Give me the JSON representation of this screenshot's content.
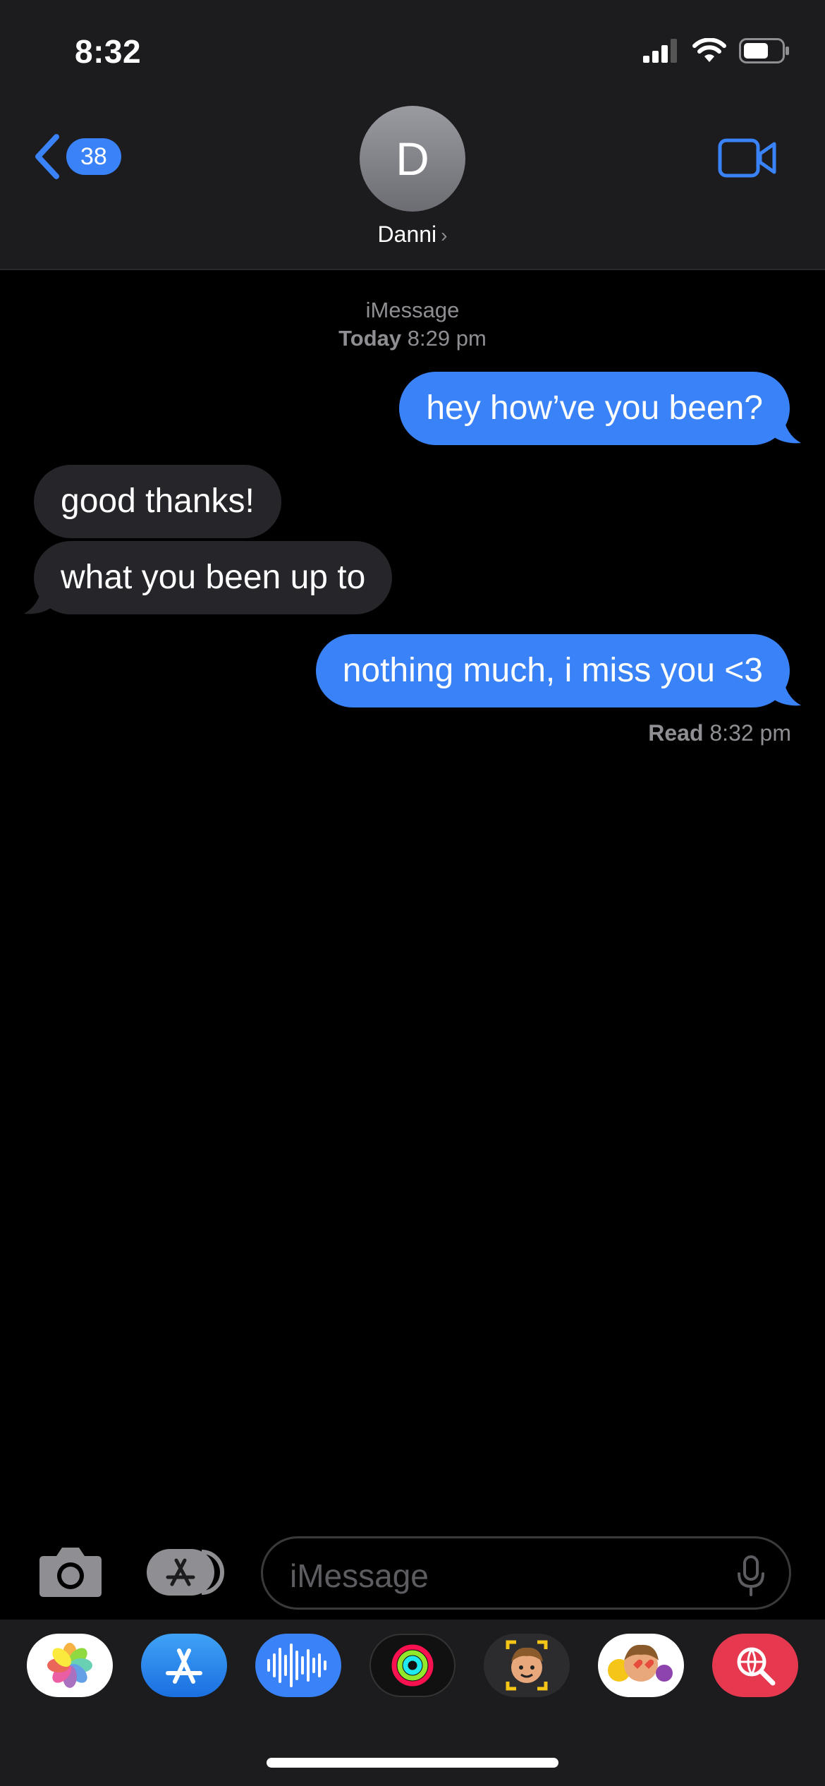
{
  "status_bar": {
    "time": "8:32"
  },
  "header": {
    "back_count": "38",
    "avatar_initial": "D",
    "contact_name": "Danni",
    "name_chevron": "›"
  },
  "conversation": {
    "service": "iMessage",
    "timestamp_day": "Today",
    "timestamp_time": "8:29 pm",
    "messages": [
      {
        "direction": "sent",
        "text": "hey how’ve you been?"
      },
      {
        "direction": "received",
        "text": "good thanks!"
      },
      {
        "direction": "received",
        "text": "what you been up to"
      },
      {
        "direction": "sent",
        "text": "nothing much, i miss you <3"
      }
    ],
    "read_label": "Read",
    "read_time": "8:32 pm"
  },
  "composer": {
    "placeholder": "iMessage",
    "icons": [
      "camera-icon",
      "app-store-toggle-icon",
      "microphone-icon"
    ]
  },
  "app_drawer": {
    "apps": [
      "photos-app-icon",
      "app-store-app-icon",
      "audio-message-app-icon",
      "activity-app-icon",
      "memoji-app-icon",
      "memoji-stickers-app-icon",
      "images-search-app-icon"
    ]
  },
  "colors": {
    "accent": "#3a82f7",
    "received_bubble": "#26252a",
    "header_bg": "#1c1c1e",
    "secondary_text": "#8e8e93"
  }
}
